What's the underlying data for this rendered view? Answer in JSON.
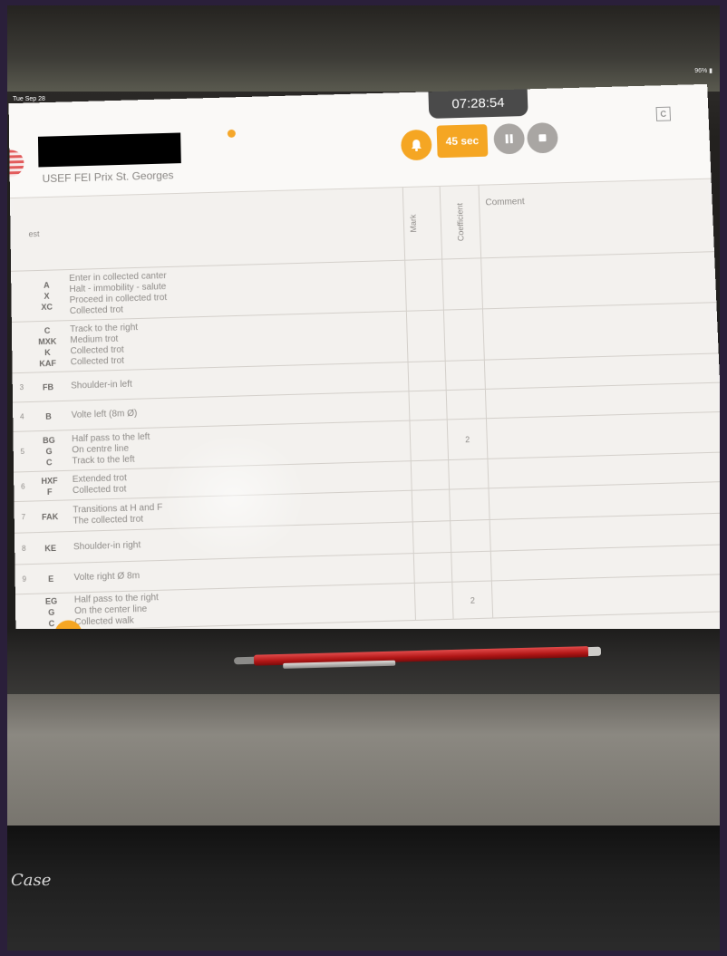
{
  "status": {
    "time": "Tue Sep 28",
    "battery": "96% ▮"
  },
  "header": {
    "rider_name": "",
    "test_name": "USEF FEI Prix St. Georges",
    "timer": "07:28:54",
    "countdown_label": "45 sec",
    "corner_label": "C"
  },
  "columns": {
    "test": "est",
    "mark": "Mark",
    "coefficient": "Coefficient",
    "comment": "Comment"
  },
  "rows": [
    {
      "num": "",
      "letters": [
        "A",
        "X",
        "",
        "XC"
      ],
      "movements": [
        "Enter in collected canter",
        "Halt - immobility - salute",
        "Proceed in collected trot",
        "Collected trot"
      ],
      "coef": ""
    },
    {
      "num": "",
      "letters": [
        "C",
        "MXK",
        "K",
        "KAF"
      ],
      "movements": [
        "Track to the right",
        "Medium trot",
        "Collected trot",
        "Collected trot"
      ],
      "coef": ""
    },
    {
      "num": "3",
      "letters": [
        "FB"
      ],
      "movements": [
        "Shoulder-in left"
      ],
      "coef": ""
    },
    {
      "num": "4",
      "letters": [
        "B"
      ],
      "movements": [
        "Volte left (8m Ø)"
      ],
      "coef": ""
    },
    {
      "num": "5",
      "letters": [
        "BG",
        "G",
        "C"
      ],
      "movements": [
        "Half pass to the left",
        "On centre line",
        "Track to the left"
      ],
      "coef": "2"
    },
    {
      "num": "6",
      "letters": [
        "HXF",
        "F"
      ],
      "movements": [
        "Extended trot",
        "Collected trot"
      ],
      "coef": ""
    },
    {
      "num": "7",
      "letters": [
        "",
        "FAK"
      ],
      "movements": [
        "Transitions at H and F",
        "The collected trot"
      ],
      "coef": ""
    },
    {
      "num": "8",
      "letters": [
        "KE"
      ],
      "movements": [
        "Shoulder-in right"
      ],
      "coef": ""
    },
    {
      "num": "9",
      "letters": [
        "E"
      ],
      "movements": [
        "Volte right Ø 8m"
      ],
      "coef": ""
    },
    {
      "num": "",
      "letters": [
        "EG",
        "G",
        "C"
      ],
      "movements": [
        "Half pass to the right",
        "On the center line",
        "Collected walk"
      ],
      "coef": "2"
    }
  ],
  "case": {
    "brand": "Case"
  },
  "icons": {
    "bell": "bell-icon",
    "pause": "pause-icon",
    "stop": "stop-icon",
    "menu": "menu-icon"
  },
  "colors": {
    "accent": "#f5a623",
    "muted_button": "#a9a6a3"
  }
}
